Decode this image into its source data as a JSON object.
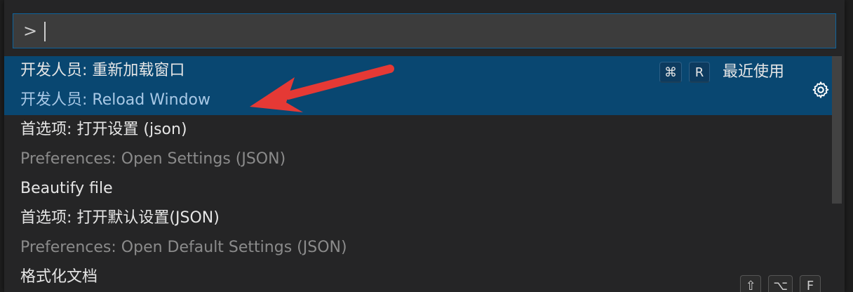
{
  "quick_open": {
    "input_value": ">",
    "items": [
      {
        "primary": "开发人员: 重新加载窗口",
        "secondary": "开发人员: Reload Window",
        "selected": true,
        "keybinding": [
          "⌘",
          "R"
        ],
        "tag": "最近使用",
        "gear_icon": "gear-icon"
      },
      {
        "primary": "首选项: 打开设置 (json)",
        "secondary": "Preferences: Open Settings (JSON)",
        "selected": false
      },
      {
        "primary": "Beautify file",
        "secondary": "",
        "selected": false
      },
      {
        "primary": "首选项: 打开默认设置(JSON)",
        "secondary": "Preferences: Open Default Settings (JSON)",
        "selected": false
      },
      {
        "primary": "格式化文档",
        "secondary": "",
        "selected": false,
        "keybinding": [
          "⇧",
          "⌥",
          "F"
        ]
      }
    ]
  },
  "colors": {
    "accent_border": "#0e639c",
    "selection_bg": "#094771",
    "arrow": "#e53935"
  }
}
